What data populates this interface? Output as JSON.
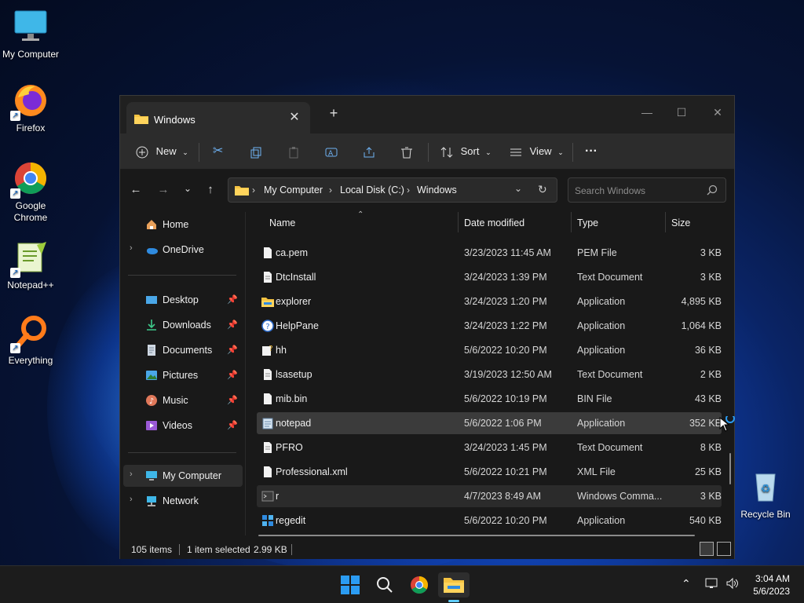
{
  "desktop": {
    "icons": [
      {
        "label": "My Computer",
        "icon": "monitor-icon"
      },
      {
        "label": "Firefox",
        "icon": "firefox-icon"
      },
      {
        "label": "Google Chrome",
        "icon": "chrome-icon"
      },
      {
        "label": "Notepad++",
        "icon": "notepadpp-icon"
      },
      {
        "label": "Everything",
        "icon": "everything-icon"
      },
      {
        "label": "Recycle Bin",
        "icon": "recycle-bin-icon"
      }
    ]
  },
  "window": {
    "tab_title": "Windows",
    "toolbar": {
      "new_label": "New",
      "sort_label": "Sort",
      "view_label": "View",
      "more_label": "···"
    },
    "address": {
      "crumbs": [
        "My Computer",
        "Local Disk (C:)",
        "Windows"
      ]
    },
    "search": {
      "placeholder": "Search Windows"
    },
    "sidebar": {
      "items": [
        {
          "label": "Home",
          "icon": "home-icon"
        },
        {
          "label": "OneDrive",
          "icon": "onedrive-icon"
        },
        {
          "label": "Desktop",
          "icon": "desktop-folder-icon",
          "pinned": true
        },
        {
          "label": "Downloads",
          "icon": "downloads-icon",
          "pinned": true
        },
        {
          "label": "Documents",
          "icon": "documents-icon",
          "pinned": true
        },
        {
          "label": "Pictures",
          "icon": "pictures-icon",
          "pinned": true
        },
        {
          "label": "Music",
          "icon": "music-icon",
          "pinned": true
        },
        {
          "label": "Videos",
          "icon": "videos-icon",
          "pinned": true
        },
        {
          "label": "My Computer",
          "icon": "monitor-icon"
        },
        {
          "label": "Network",
          "icon": "network-icon"
        }
      ]
    },
    "columns": {
      "name": "Name",
      "date": "Date modified",
      "type": "Type",
      "size": "Size"
    },
    "files": [
      {
        "name": "ca.pem",
        "date": "3/23/2023 11:45 AM",
        "type": "PEM File",
        "size": "3 KB",
        "icon": "file-icon"
      },
      {
        "name": "DtcInstall",
        "date": "3/24/2023 1:39 PM",
        "type": "Text Document",
        "size": "3 KB",
        "icon": "text-file-icon"
      },
      {
        "name": "explorer",
        "date": "3/24/2023 1:20 PM",
        "type": "Application",
        "size": "4,895 KB",
        "icon": "explorer-app-icon"
      },
      {
        "name": "HelpPane",
        "date": "3/24/2023 1:22 PM",
        "type": "Application",
        "size": "1,064 KB",
        "icon": "help-icon"
      },
      {
        "name": "hh",
        "date": "5/6/2022 10:20 PM",
        "type": "Application",
        "size": "36 KB",
        "icon": "hh-app-icon"
      },
      {
        "name": "lsasetup",
        "date": "3/19/2023 12:50 AM",
        "type": "Text Document",
        "size": "2 KB",
        "icon": "text-file-icon"
      },
      {
        "name": "mib.bin",
        "date": "5/6/2022 10:19 PM",
        "type": "BIN File",
        "size": "43 KB",
        "icon": "file-icon"
      },
      {
        "name": "notepad",
        "date": "5/6/2022 1:06 PM",
        "type": "Application",
        "size": "352 KB",
        "icon": "notepad-app-icon"
      },
      {
        "name": "PFRO",
        "date": "3/24/2023 1:45 PM",
        "type": "Text Document",
        "size": "8 KB",
        "icon": "text-file-icon"
      },
      {
        "name": "Professional.xml",
        "date": "5/6/2022 10:21 PM",
        "type": "XML File",
        "size": "25 KB",
        "icon": "file-icon"
      },
      {
        "name": "r",
        "date": "4/7/2023 8:49 AM",
        "type": "Windows Comma...",
        "size": "3 KB",
        "icon": "cmd-file-icon"
      },
      {
        "name": "regedit",
        "date": "5/6/2022 10:20 PM",
        "type": "Application",
        "size": "540 KB",
        "icon": "regedit-icon"
      }
    ],
    "status": {
      "count": "105 items",
      "selected": "1 item selected",
      "size": "2.99 KB"
    }
  },
  "taskbar": {
    "clock_time": "3:04 AM",
    "clock_date": "5/6/2023"
  }
}
